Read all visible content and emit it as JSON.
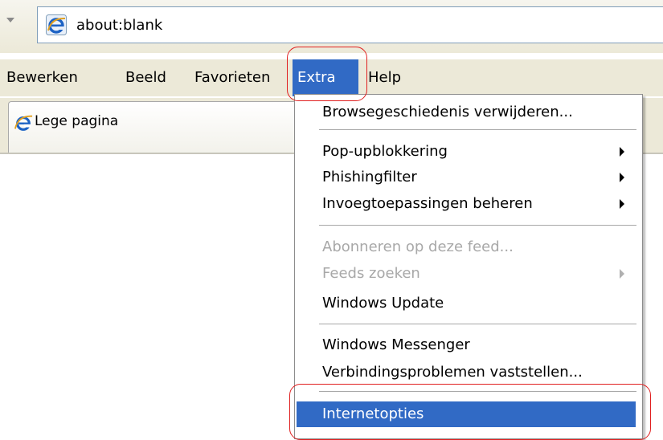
{
  "address_bar": {
    "url": "about:blank",
    "page_icon": "ie-logo-icon",
    "dropdown_icon": "dropdown-arrow-icon"
  },
  "menubar": {
    "items": [
      {
        "label": "Bewerken"
      },
      {
        "label": "Beeld"
      },
      {
        "label": "Favorieten"
      },
      {
        "label": "Extra"
      },
      {
        "label": "Help"
      }
    ]
  },
  "tabs": [
    {
      "label": "Lege pagina",
      "icon": "ie-logo-icon"
    }
  ],
  "extra_menu": {
    "items": [
      {
        "label": "Browsegeschiedenis verwijderen...",
        "enabled": true,
        "submenu": false
      },
      {
        "label": "Pop-upblokkering",
        "enabled": true,
        "submenu": true
      },
      {
        "label": "Phishingfilter",
        "enabled": true,
        "submenu": true
      },
      {
        "label": "Invoegtoepassingen beheren",
        "enabled": true,
        "submenu": true
      },
      {
        "label": "Abonneren op deze feed...",
        "enabled": false,
        "submenu": false
      },
      {
        "label": "Feeds zoeken",
        "enabled": false,
        "submenu": true
      },
      {
        "label": "Windows Update",
        "enabled": true,
        "submenu": false
      },
      {
        "label": "Windows Messenger",
        "enabled": true,
        "submenu": false
      },
      {
        "label": "Verbindingsproblemen vaststellen...",
        "enabled": true,
        "submenu": false
      },
      {
        "label": "Internetopties",
        "enabled": true,
        "submenu": false,
        "highlighted": true
      }
    ]
  },
  "colors": {
    "menu_highlight": "#316ac5",
    "annotation": "#e02020",
    "chrome_bg": "#ece9d8",
    "disabled_text": "#a8a8a8"
  }
}
